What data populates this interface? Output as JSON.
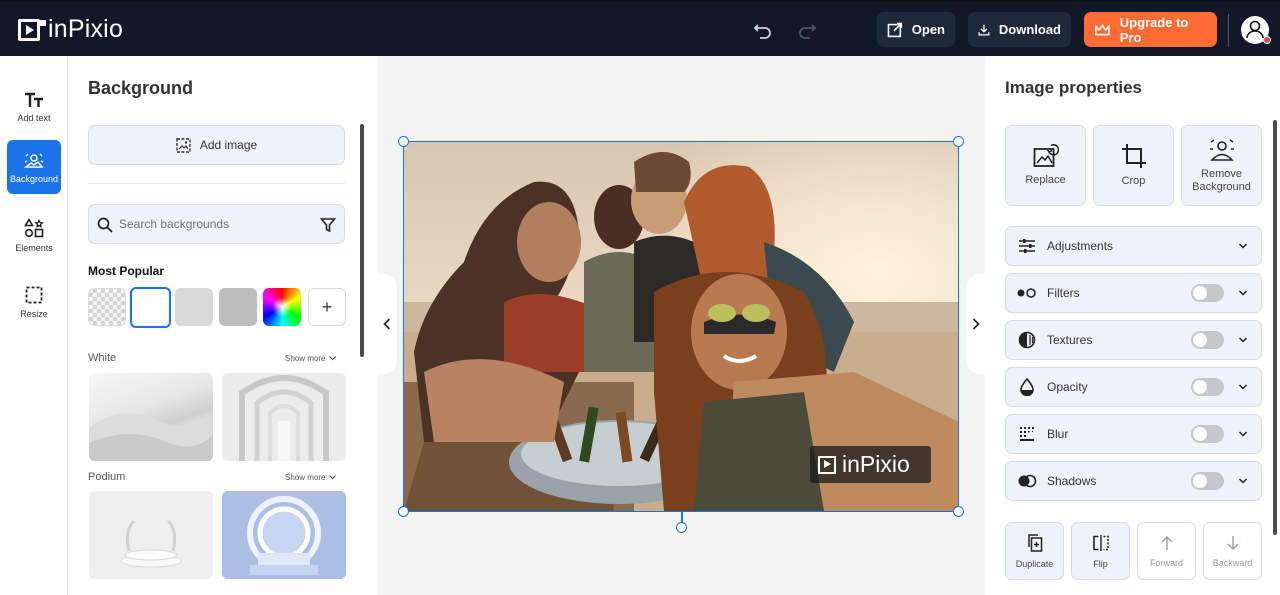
{
  "app": {
    "brand": "inPixio"
  },
  "topbar": {
    "open_label": "Open",
    "download_label": "Download",
    "upgrade_label": "Upgrade to Pro",
    "upgrade_color": "#ff6b35"
  },
  "leftnav": {
    "items": [
      {
        "label": "Add text",
        "icon": "text-icon"
      },
      {
        "label": "Background",
        "icon": "background-icon",
        "active": true
      },
      {
        "label": "Elements",
        "icon": "elements-icon"
      },
      {
        "label": "Resize",
        "icon": "resize-icon"
      }
    ]
  },
  "background_panel": {
    "title": "Background",
    "add_image_label": "Add image",
    "search_placeholder": "Search backgrounds",
    "most_popular_label": "Most Popular",
    "sections": [
      {
        "label": "White",
        "show_more": "Show more"
      },
      {
        "label": "Podium",
        "show_more": "Show more"
      }
    ]
  },
  "canvas": {
    "watermark_text": "inPixio",
    "accent_color": "#1b73e8"
  },
  "properties_panel": {
    "title": "Image properties",
    "tiles": [
      {
        "label": "Replace",
        "icon": "replace-image-icon"
      },
      {
        "label": "Crop",
        "icon": "crop-icon"
      },
      {
        "label": "Remove Background",
        "icon": "remove-background-icon"
      }
    ],
    "rows": [
      {
        "label": "Adjustments",
        "icon": "sliders-icon",
        "toggle": null
      },
      {
        "label": "Filters",
        "icon": "filters-icon",
        "toggle": false
      },
      {
        "label": "Textures",
        "icon": "textures-icon",
        "toggle": false
      },
      {
        "label": "Opacity",
        "icon": "drop-icon",
        "toggle": false
      },
      {
        "label": "Blur",
        "icon": "blur-icon",
        "toggle": false
      },
      {
        "label": "Shadows",
        "icon": "shadows-icon",
        "toggle": false
      }
    ],
    "actions": [
      {
        "label": "Duplicate",
        "icon": "duplicate-icon",
        "enabled": true
      },
      {
        "label": "Flip",
        "icon": "flip-icon",
        "enabled": true
      },
      {
        "label": "Forward",
        "icon": "arrow-up-icon",
        "enabled": false
      },
      {
        "label": "Backward",
        "icon": "arrow-down-icon",
        "enabled": false
      }
    ]
  }
}
